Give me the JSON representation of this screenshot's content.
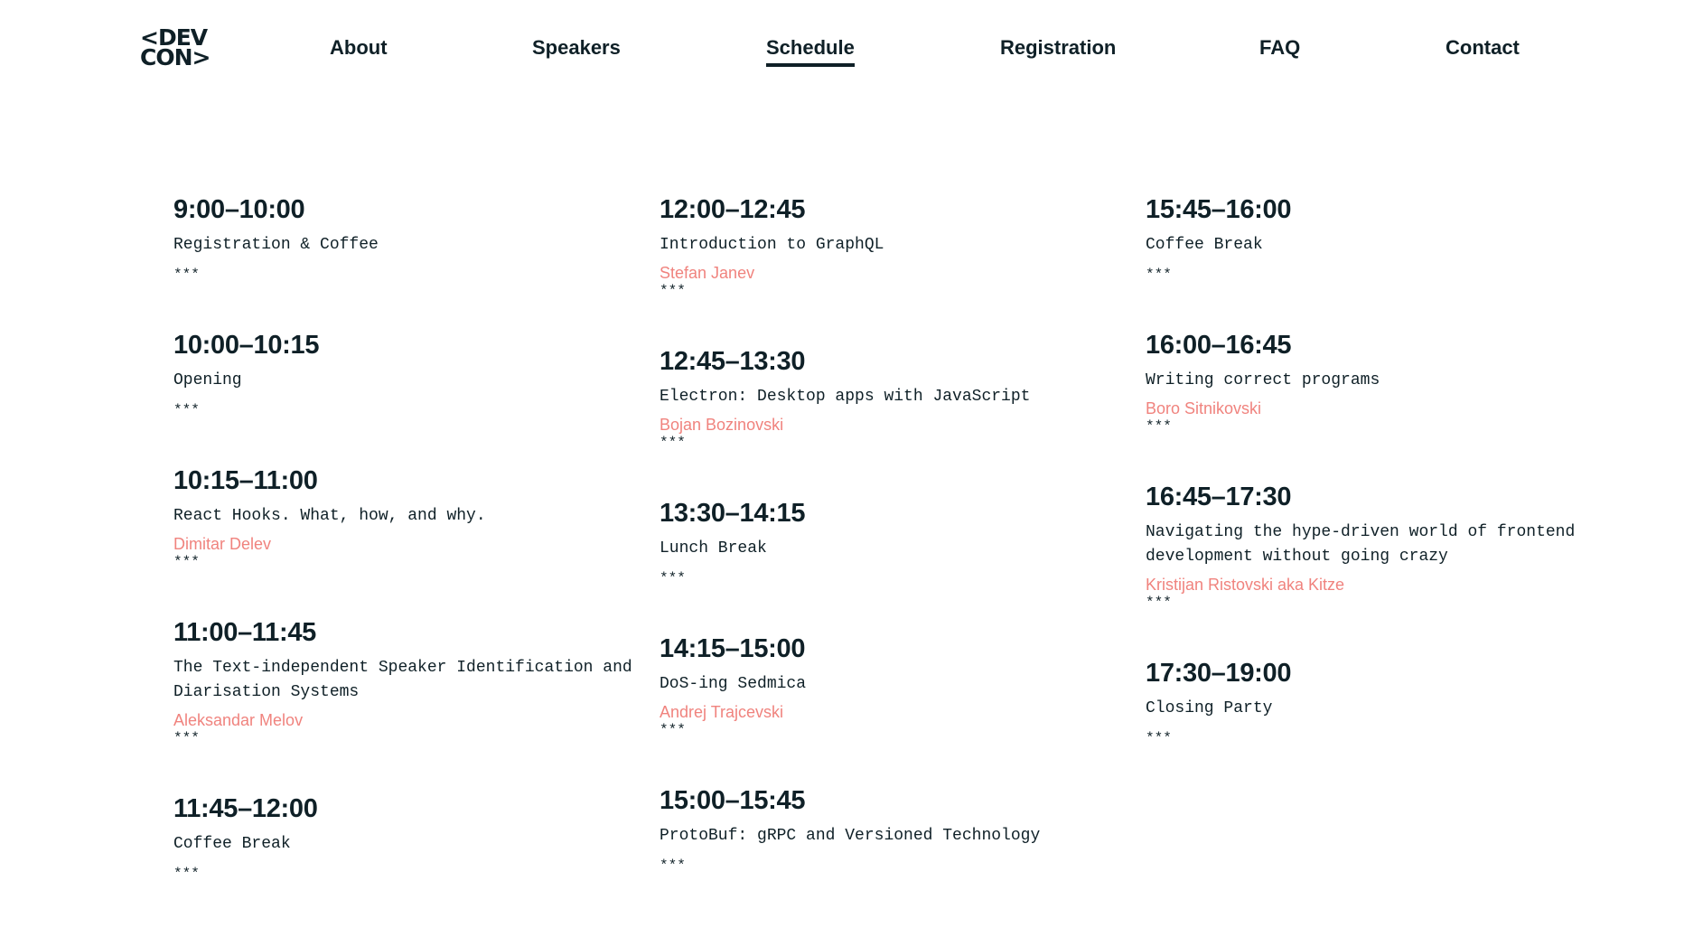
{
  "logo": {
    "line1": "<DEV",
    "line2": "CON>"
  },
  "nav": [
    {
      "label": "About"
    },
    {
      "label": "Speakers"
    },
    {
      "label": "Schedule",
      "active": true
    },
    {
      "label": "Registration"
    },
    {
      "label": "FAQ"
    },
    {
      "label": "Contact"
    }
  ],
  "schedule": {
    "separator": "***",
    "columns": [
      [
        {
          "time": "9:00–10:00",
          "title": "Registration & Coffee",
          "speaker": ""
        },
        {
          "time": "10:00–10:15",
          "title": "Opening",
          "speaker": ""
        },
        {
          "time": "10:15–11:00",
          "title": "React Hooks. What, how, and why.",
          "speaker": "Dimitar Delev"
        },
        {
          "time": "11:00–11:45",
          "title": "The Text-independent Speaker Identification and Diarisation Systems",
          "speaker": "Aleksandar Melov"
        },
        {
          "time": "11:45–12:00",
          "title": "Coffee Break",
          "speaker": ""
        }
      ],
      [
        {
          "time": "12:00–12:45",
          "title": "Introduction to GraphQL",
          "speaker": "Stefan Janev"
        },
        {
          "time": "12:45–13:30",
          "title": "Electron: Desktop apps with JavaScript",
          "speaker": "Bojan Bozinovski"
        },
        {
          "time": "13:30–14:15",
          "title": "Lunch Break",
          "speaker": ""
        },
        {
          "time": "14:15–15:00",
          "title": "DoS-ing Sedmica",
          "speaker": "Andrej Trajcevski"
        },
        {
          "time": "15:00–15:45",
          "title": "ProtoBuf: gRPC and Versioned Technology",
          "speaker": ""
        }
      ],
      [
        {
          "time": "15:45–16:00",
          "title": "Coffee Break",
          "speaker": ""
        },
        {
          "time": "16:00–16:45",
          "title": "Writing correct programs",
          "speaker": "Boro Sitnikovski"
        },
        {
          "time": "16:45–17:30",
          "title": "Navigating the hype-driven world of frontend development without going crazy",
          "speaker": "Kristijan Ristovski aka Kitze"
        },
        {
          "time": "17:30–19:00",
          "title": "Closing Party",
          "speaker": ""
        }
      ]
    ]
  },
  "colors": {
    "text": "#0f2027",
    "speaker": "#f0837e",
    "background": "#ffffff"
  }
}
